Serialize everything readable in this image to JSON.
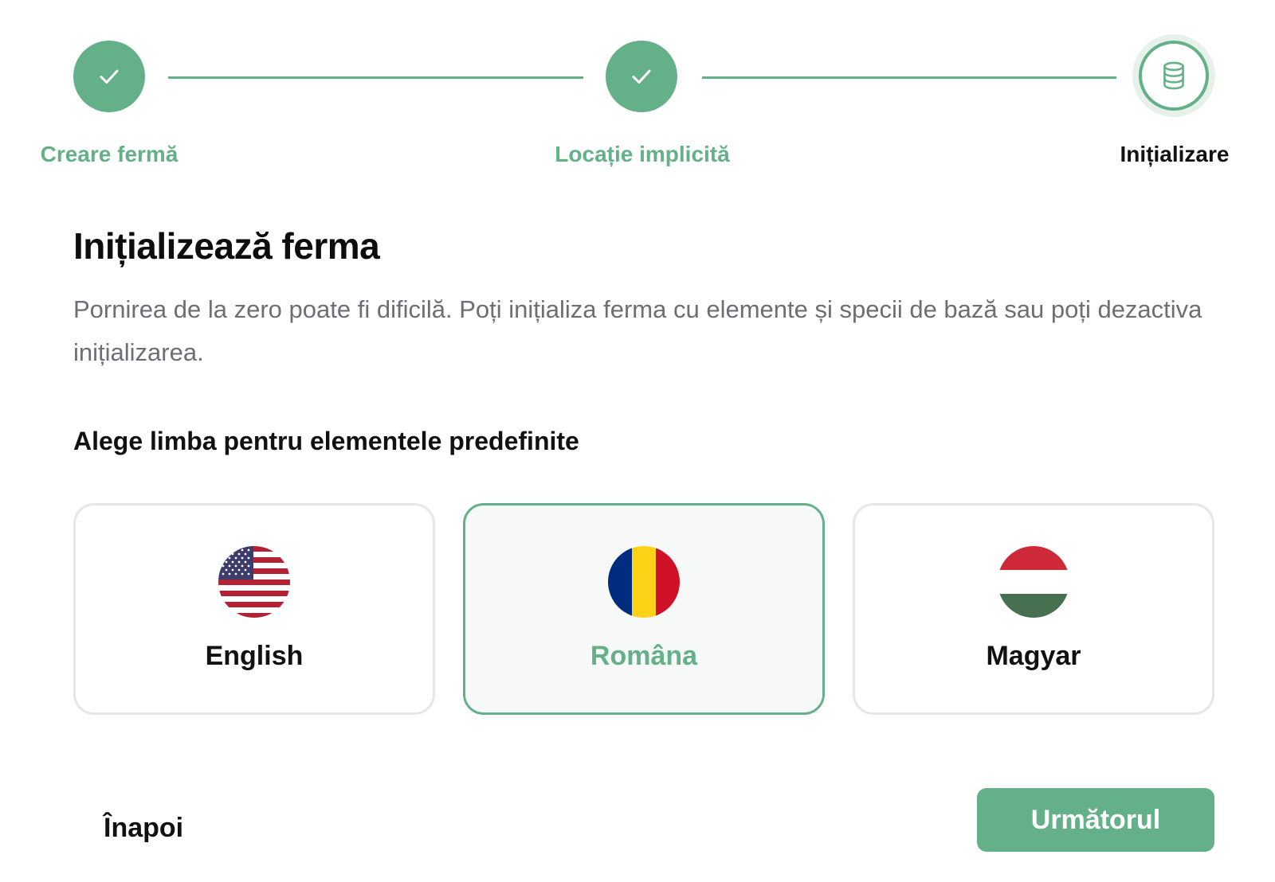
{
  "stepper": {
    "steps": [
      {
        "label": "Creare fermă",
        "status": "done",
        "icon": "check-icon"
      },
      {
        "label": "Locație implicită",
        "status": "done",
        "icon": "check-icon"
      },
      {
        "label": "Inițializare",
        "status": "current",
        "icon": "database-icon"
      }
    ]
  },
  "main": {
    "title": "Inițializează ferma",
    "description": "Pornirea de la zero poate fi dificilă. Poți inițializa ferma cu elemente și specii de bază sau poți dezactiva inițializarea.",
    "language_prompt": "Alege limba pentru elementele predefinite",
    "languages": [
      {
        "label": "English",
        "flag": "us-flag-icon",
        "selected": false
      },
      {
        "label": "Româna",
        "flag": "romania-flag-icon",
        "selected": true
      },
      {
        "label": "Magyar",
        "flag": "hungary-flag-icon",
        "selected": false
      }
    ]
  },
  "footer": {
    "back_label": "Înapoi",
    "next_label": "Următorul"
  },
  "colors": {
    "accent": "#64b088",
    "text": "#111111",
    "muted_text": "#6b6f75",
    "card_border": "#e4e6ea",
    "selected_card_bg": "#f6f9f8"
  }
}
